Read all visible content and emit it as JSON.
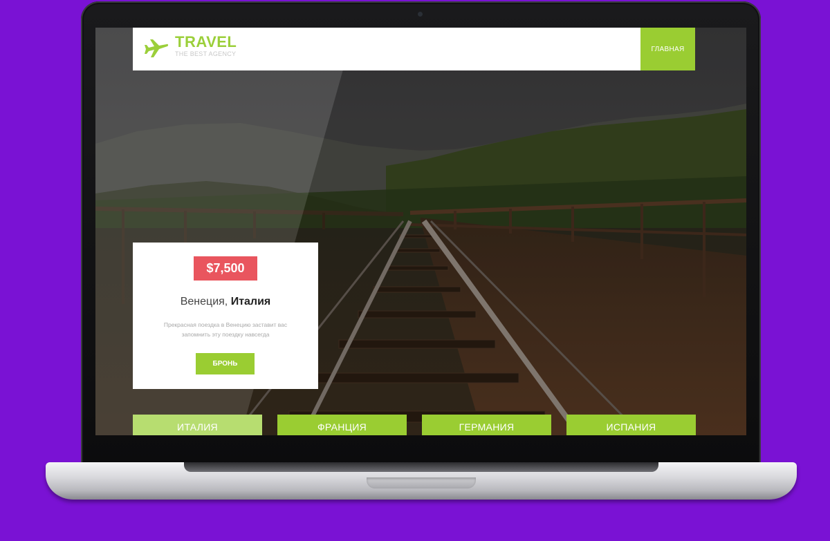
{
  "brand": {
    "title": "TRAVEL",
    "subtitle": "THE BEST AGENCY",
    "accent_color": "#9acd32",
    "logo_icon": "airplane-icon"
  },
  "nav": {
    "home_label": "ГЛАВНАЯ"
  },
  "offer": {
    "price": "$7,500",
    "price_color": "#e9555e",
    "city": "Венеция,",
    "country": "Италия",
    "description": "Прекрасная поездка в Венецию заставит вас запомнить эту поездку навсегда",
    "book_label": "БРОНЬ"
  },
  "tabs": [
    {
      "label": "ИТАЛИЯ"
    },
    {
      "label": "ФРАНЦИЯ"
    },
    {
      "label": "ГЕРМАНИЯ"
    },
    {
      "label": "ИСПАНИЯ"
    }
  ],
  "background": {
    "frame_color": "#7a12d4",
    "scene": "railway-bridge-photo"
  }
}
